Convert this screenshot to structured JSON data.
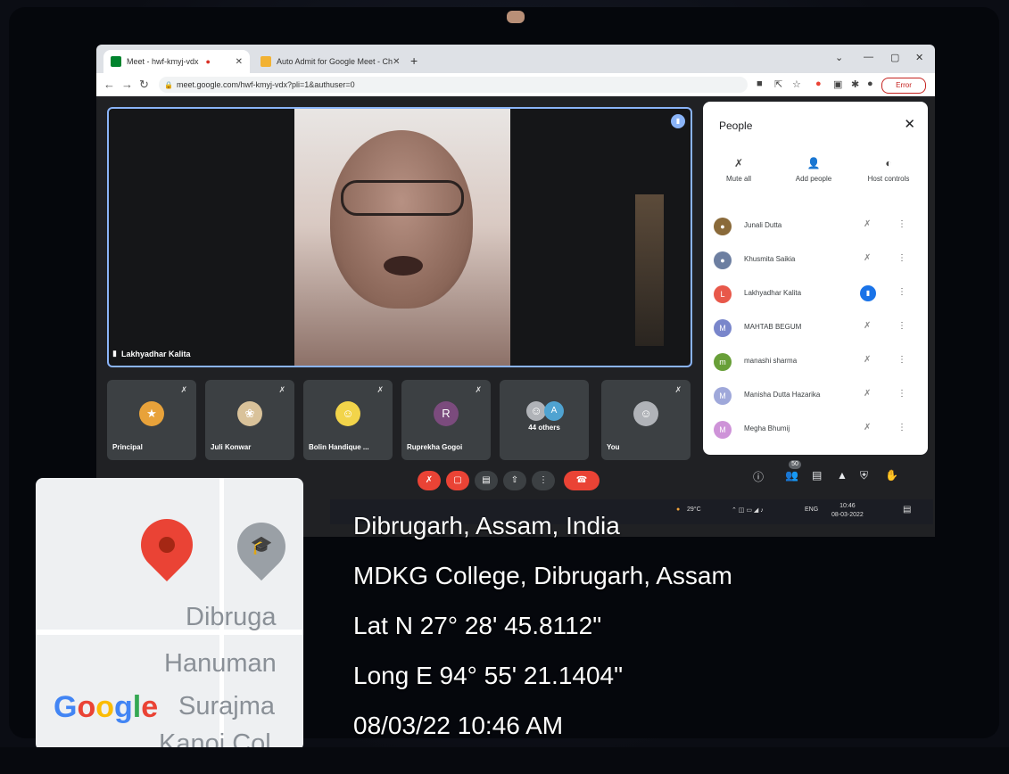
{
  "browser": {
    "tabs": [
      {
        "label": "Meet - hwf-kmyj-vdx",
        "active": true
      },
      {
        "label": "Auto Admit for Google Meet - Ch",
        "active": false
      }
    ],
    "url": "meet.google.com/hwf-kmyj-vdx?pli=1&authuser=0",
    "error_label": "Error"
  },
  "meet": {
    "main_speaker": "Lakhyadhar Kalita",
    "participants_count_badge": "50",
    "strip": [
      {
        "name": "Principal",
        "avatar": "",
        "color": "#e8a23a"
      },
      {
        "name": "Juli Konwar",
        "avatar": "",
        "color": "#d9c29a"
      },
      {
        "name": "Bolin Handique ...",
        "avatar": "",
        "color": "#f2d44a"
      },
      {
        "name": "Ruprekha Gogoi",
        "avatar": "R",
        "color": "#7b4b7d"
      },
      {
        "name": "44 others",
        "avatar": "A",
        "color": "#4fa3d1"
      },
      {
        "name": "You",
        "avatar": "",
        "color": "#b0b3b8"
      }
    ]
  },
  "people_panel": {
    "title": "People",
    "actions": [
      {
        "label": "Mute all",
        "icon": "mic-off-icon"
      },
      {
        "label": "Add people",
        "icon": "person-add-icon"
      },
      {
        "label": "Host controls",
        "icon": "toggle-icon"
      }
    ],
    "rows": [
      {
        "name": "Junali Dutta",
        "avatar": "",
        "color": "#8a6a3a",
        "speaking": false
      },
      {
        "name": "Khusmita Saikia",
        "avatar": "",
        "color": "#6d7fa1",
        "speaking": false
      },
      {
        "name": "Lakhyadhar Kalita",
        "avatar": "L",
        "color": "#e8584a",
        "speaking": true
      },
      {
        "name": "MAHTAB BEGUM",
        "avatar": "M",
        "color": "#7986cb",
        "speaking": false
      },
      {
        "name": "manashi sharma",
        "avatar": "m",
        "color": "#689f38",
        "speaking": false
      },
      {
        "name": "Manisha Dutta Hazarika",
        "avatar": "M",
        "color": "#9fa8da",
        "speaking": false
      },
      {
        "name": "Megha Bhumij",
        "avatar": "M",
        "color": "#ce93d8",
        "speaking": false
      }
    ]
  },
  "taskbar": {
    "weather": "29°C",
    "lang": "ENG",
    "time": "10:46",
    "date": "08-03-2022"
  },
  "map": {
    "labels": [
      "Dibruga",
      "Hanuman",
      "Surajma",
      "Kanoi Col"
    ],
    "logo": "Google"
  },
  "geotag": {
    "line1": "Dibrugarh, Assam, India",
    "line2": "MDKG College, Dibrugarh, Assam",
    "line3": "Lat N 27° 28' 45.8112\"",
    "line4": "Long E 94° 55' 21.1404\"",
    "line5": "08/03/22 10:46 AM"
  }
}
